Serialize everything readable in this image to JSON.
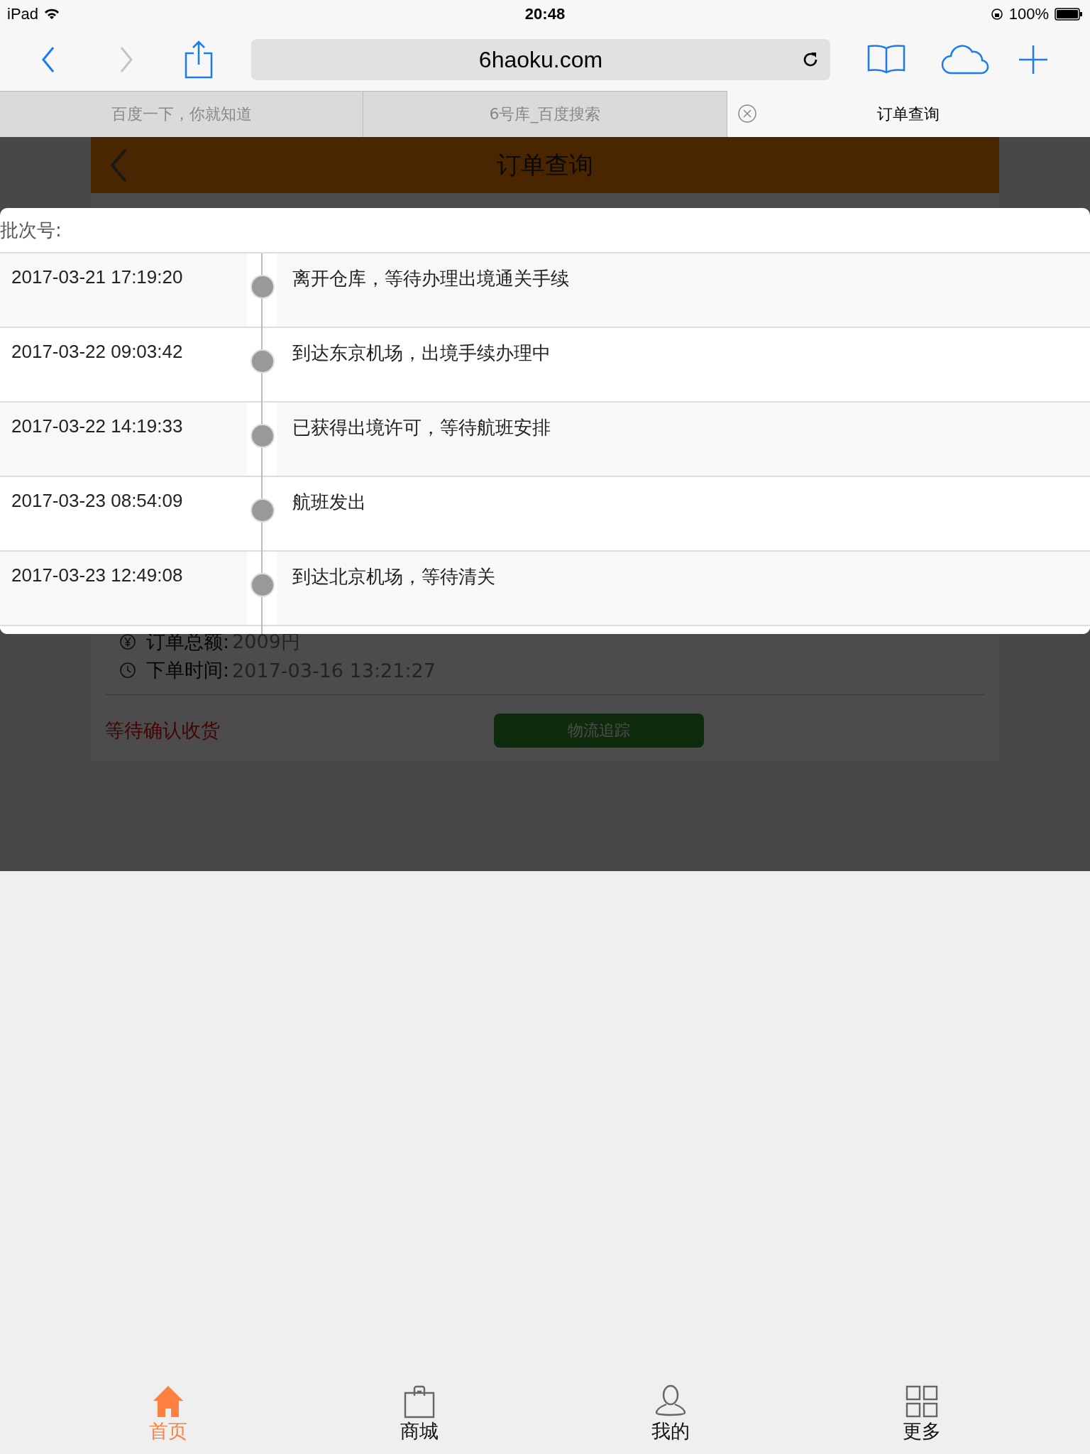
{
  "status_bar": {
    "device": "iPad",
    "time": "20:48",
    "battery": "100%"
  },
  "toolbar": {
    "url": "6haoku.com"
  },
  "tabs": [
    {
      "label": "百度一下，你就知道",
      "selected": false
    },
    {
      "label": "6号库_百度搜索",
      "selected": false
    },
    {
      "label": "订单查询",
      "selected": true
    }
  ],
  "page": {
    "title": "订单查询",
    "order": {
      "amount_label": "订单总额:",
      "amount": "2009円",
      "time_label": "下单时间:",
      "time": "2017-03-16 13:21:27",
      "status": "等待确认收货",
      "button": "物流追踪"
    }
  },
  "modal": {
    "batch_label": "批次号:",
    "events": [
      {
        "time": "2017-03-21 17:19:20",
        "text": "离开仓库，等待办理出境通关手续"
      },
      {
        "time": "2017-03-22 09:03:42",
        "text": "到达东京机场，出境手续办理中"
      },
      {
        "time": "2017-03-22 14:19:33",
        "text": "已获得出境许可，等待航班安排"
      },
      {
        "time": "2017-03-23 08:54:09",
        "text": "航班发出"
      },
      {
        "time": "2017-03-23 12:49:08",
        "text": "到达北京机场，等待清关"
      }
    ]
  },
  "bottom_nav": [
    {
      "label": "首页",
      "kind": "home",
      "selected": true
    },
    {
      "label": "商城",
      "kind": "shop",
      "selected": false
    },
    {
      "label": "我的",
      "kind": "profile",
      "selected": false
    },
    {
      "label": "更多",
      "kind": "more",
      "selected": false
    }
  ]
}
